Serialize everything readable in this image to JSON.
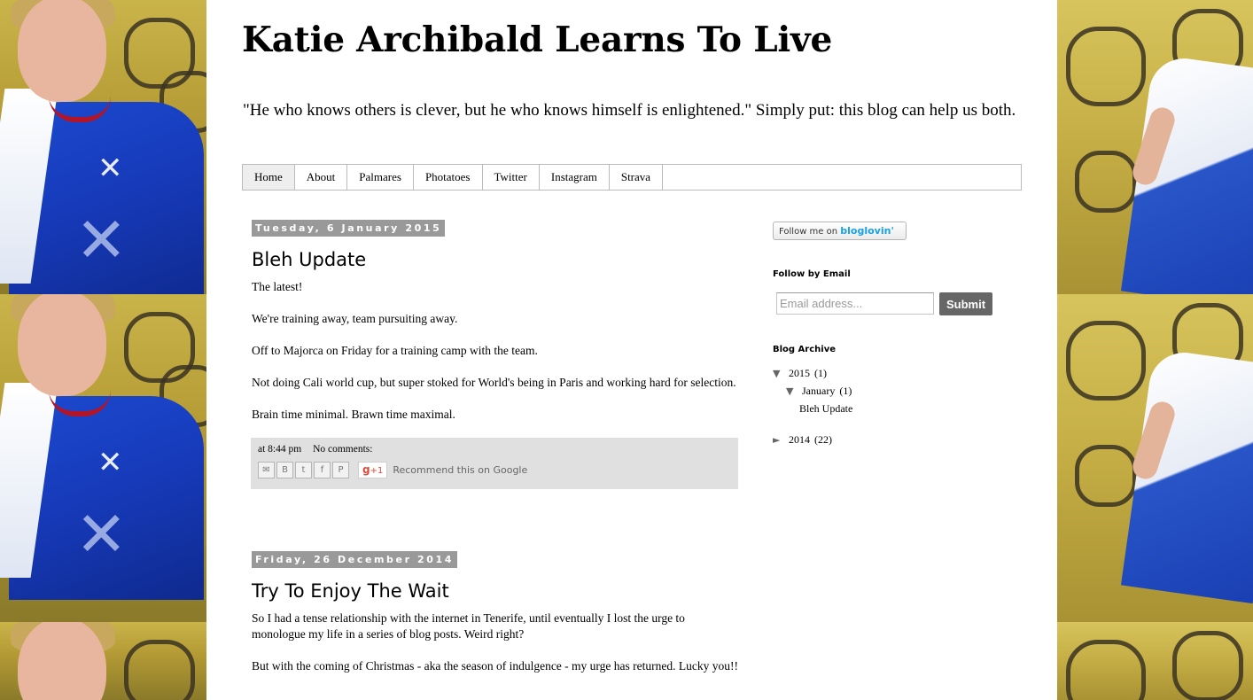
{
  "blog": {
    "title": "Katie Archibald Learns To Live",
    "description": "\"He who knows others is clever, but he who knows himself is enlightened.\" Simply put: this blog can help us both."
  },
  "tabs": [
    {
      "label": "Home",
      "active": true
    },
    {
      "label": "About"
    },
    {
      "label": "Palmares"
    },
    {
      "label": "Photatoes"
    },
    {
      "label": "Twitter"
    },
    {
      "label": "Instagram"
    },
    {
      "label": "Strava"
    }
  ],
  "posts": [
    {
      "date": "Tuesday, 6 January 2015",
      "title": "Bleh Update",
      "paragraphs": [
        "The latest!",
        "We're training away, team pursuiting away.",
        "Off to Majorca on Friday for a training camp with the team.",
        "Not doing Cali world cup, but super stoked for World's being in Paris and working hard for selection.",
        "Brain time minimal. Brawn time maximal."
      ],
      "footer": {
        "time": "at 8:44 pm",
        "comments": "No comments:",
        "gplus_label": "+1",
        "recommend": "Recommend this on Google"
      }
    },
    {
      "date": "Friday, 26 December 2014",
      "title": "Try To Enjoy The Wait",
      "paragraphs": [
        "So I had a tense relationship with the internet in Tenerife, until eventually I lost the urge to monologue my life in a series of blog posts. Weird right?",
        "But with the coming of Christmas - aka the season of indulgence - my urge has returned. Lucky you!!"
      ]
    }
  ],
  "share_icons": [
    "email-icon",
    "blogger-icon",
    "twitter-icon",
    "facebook-icon",
    "pinterest-icon"
  ],
  "sidebar": {
    "bloglovin": {
      "prefix": "Follow me on",
      "brand": "bloglovin'"
    },
    "follow_by_email": {
      "heading": "Follow by Email",
      "placeholder": "Email address...",
      "submit": "Submit"
    },
    "archive": {
      "heading": "Blog Archive",
      "years": [
        {
          "label": "2015",
          "count": "(1)",
          "expanded": true,
          "months": [
            {
              "label": "January",
              "count": "(1)",
              "expanded": true,
              "posts": [
                "Bleh Update"
              ]
            }
          ]
        },
        {
          "label": "2014",
          "count": "(22)",
          "expanded": false
        }
      ]
    }
  },
  "colors": {
    "page_bg": "#ffffff",
    "date_header_bg": "#999999",
    "footer_bg": "#e0e0e0",
    "submit_bg": "#666666",
    "bloglovin_brand": "#1ba0e1"
  }
}
